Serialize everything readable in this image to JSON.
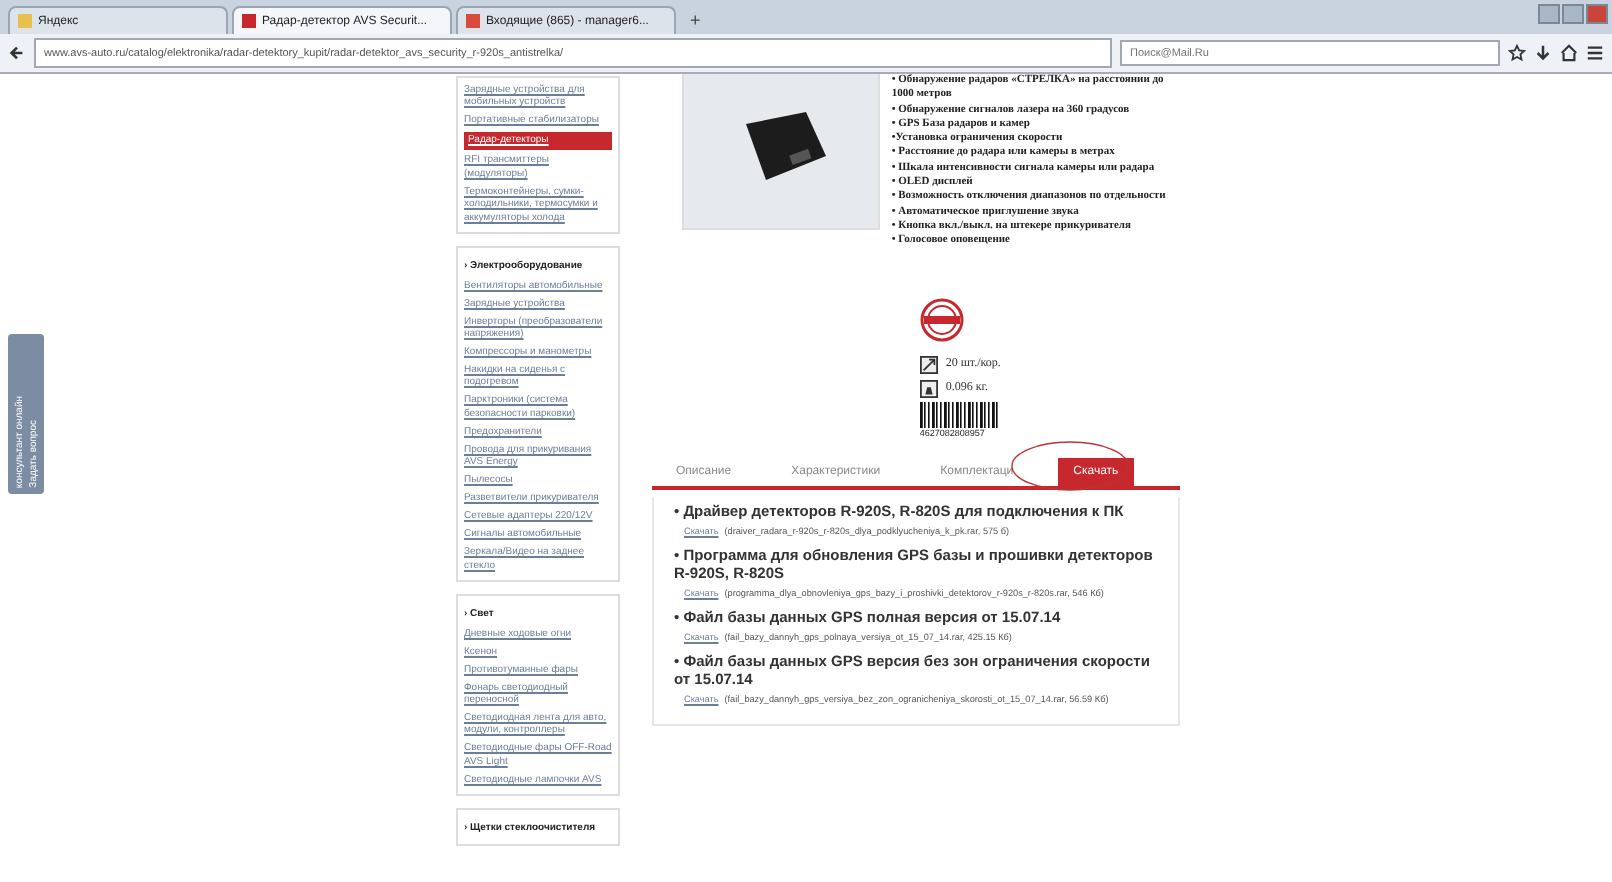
{
  "browser": {
    "tabs": [
      {
        "title": "Яндекс",
        "selected": false
      },
      {
        "title": "Радар-детектор AVS Securit...",
        "selected": true
      },
      {
        "title": "Входящие (865) - manager6...",
        "selected": false
      }
    ],
    "new_tab": "+",
    "url": "www.avs-auto.ru/catalog/elektronika/radar-detektory_kupit/radar-detektor_avs_security_r-920s_antistrelka/",
    "search": {
      "placeholder": "Поиск@Mail.Ru"
    }
  },
  "feedback_tab": {
    "label": "Задать вопрос",
    "sublabel": "консультант онлайн"
  },
  "sidebar": [
    {
      "items": [
        {
          "label": "Зарядные устройства для мобильных устройств",
          "selected": false
        },
        {
          "label": "Портативные стабилизаторы",
          "selected": false
        },
        {
          "label": "Радар-детекторы",
          "selected": true
        },
        {
          "label": "RFI трансмиттеры (модуляторы)",
          "selected": false
        },
        {
          "label": "Термоконтейнеры, сумки-холодильники, термосумки и аккумуляторы холода",
          "selected": false
        }
      ]
    },
    {
      "heading": "› Электрооборудование",
      "items": [
        {
          "label": "Вентиляторы автомобильные",
          "selected": false
        },
        {
          "label": "Зарядные устройства",
          "selected": false
        },
        {
          "label": "Инверторы (преобразователи напряжения)",
          "selected": false
        },
        {
          "label": "Компрессоры и манометры",
          "selected": false
        },
        {
          "label": "Накидки на сиденья с подогревом",
          "selected": false
        },
        {
          "label": "Парктроники (система безопасности парковки)",
          "selected": false
        },
        {
          "label": "Предохранители",
          "selected": false
        },
        {
          "label": "Провода для прикуривания AVS Energy",
          "selected": false
        },
        {
          "label": "Пылесосы",
          "selected": false
        },
        {
          "label": "Разветвители прикуривателя",
          "selected": false
        },
        {
          "label": "Сетевые адаптеры 220/12V",
          "selected": false
        },
        {
          "label": "Сигналы автомобильные",
          "selected": false
        },
        {
          "label": "Зеркала/Видео на заднее стекло",
          "selected": false
        }
      ]
    },
    {
      "heading": "› Свет",
      "items": [
        {
          "label": "Дневные ходовые огни",
          "selected": false
        },
        {
          "label": "Ксенон",
          "selected": false
        },
        {
          "label": "Противотуманные фары",
          "selected": false
        },
        {
          "label": "Фонарь светодиодный переносной",
          "selected": false
        },
        {
          "label": "Светодиодная лента для авто, модули, контроллеры",
          "selected": false
        },
        {
          "label": "Светодиодные фары OFF-Road AVS Light",
          "selected": false
        },
        {
          "label": "Светодиодные лампочки AVS",
          "selected": false
        }
      ]
    },
    {
      "heading": "› Щетки стеклоочистителя"
    }
  ],
  "product": {
    "features": [
      "• Обнаружение радаров «СТРЕЛКА» на расстоянии до 1000 метров",
      "• Обнаружение сигналов лазера на 360 градусов",
      "• GPS База радаров и камер",
      "•Установка ограничения скорости",
      "• Расстояние до радара или камеры в метрах",
      "• Шкала интенсивности сигнала камеры или радара",
      "• OLED дисплей",
      "• Возможность отключения диапазонов по отдельности",
      "• Автоматическое приглушение звука",
      "• Кнопка вкл./выкл. на штекере прикуривателя",
      "• Голосовое оповещение"
    ],
    "package": "20 шт./кор.",
    "weight": "0.096 кг.",
    "barcode": "4627082808957"
  },
  "tabs": [
    {
      "label": "Описание",
      "selected": false
    },
    {
      "label": "Характеристики",
      "selected": false
    },
    {
      "label": "Комплектаци",
      "selected": false
    },
    {
      "label": "Скачать",
      "selected": true
    }
  ],
  "downloads": [
    {
      "title": "• Драйвер детекторов R-920S, R-820S для подключения к ПК",
      "link": "Скачать",
      "file": "(draiver_radara_r-920s_r-820s_dlya_podklyucheniya_k_pk.rar, 575 б)"
    },
    {
      "title": "• Программа для обновления GPS базы и прошивки детекторов R-920S, R-820S",
      "link": "Скачать",
      "file": "(programma_dlya_obnovleniya_gps_bazy_i_proshivki_detektorov_r-920s_r-820s.rar, 546 Кб)"
    },
    {
      "title": "• Файл базы данных GPS полная версия от 15.07.14",
      "link": "Скачать",
      "file": "(fail_bazy_dannyh_gps_polnaya_versiya_ot_15_07_14.rar, 425.15 Кб)"
    },
    {
      "title": "• Файл базы данных GPS версия без зон ограничения скорости от 15.07.14",
      "link": "Скачать",
      "file": "(fail_bazy_dannyh_gps_versiya_bez_zon_ogranicheniya_skorosti_ot_15_07_14.rar, 56.59 Кб)"
    }
  ]
}
